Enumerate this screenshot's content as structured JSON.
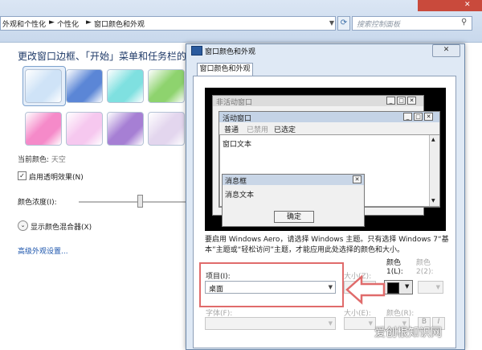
{
  "address_bar": {
    "crumbs": [
      "外观和个性化",
      "个性化",
      "窗口颜色和外观"
    ],
    "search_placeholder": "搜索控制面板"
  },
  "left": {
    "heading": "更改窗口边框、「开始」菜单和任务栏的",
    "current_color_label": "当前颜色:",
    "current_color_value": "天空",
    "transparency_label": "启用透明效果(N)",
    "transparency_checked": true,
    "intensity_label": "颜色浓度(I):",
    "intensity_level": 0.55,
    "mixer_label": "显示颜色混合器(X)",
    "advanced_link": "高级外观设置...",
    "swatch_colors": [
      "#cfe3f7",
      "#5b86d6",
      "#7fe0e0",
      "#8ed36e",
      "#f58ac9",
      "#f6c8ef",
      "#a67fd4",
      "#e3d6ee"
    ]
  },
  "dialog": {
    "title": "窗口颜色和外观",
    "close_label": "✕",
    "tab": "窗口颜色和外观",
    "preview": {
      "inactive_title": "非活动窗口",
      "active_title": "活动窗口",
      "menu": [
        "普通",
        "已禁用",
        "已选定"
      ],
      "window_text": "窗口文本",
      "message_title": "消息框",
      "message_text": "消息文本",
      "ok_label": "确定"
    },
    "description": "要启用 Windows Aero，请选择 Windows 主题。只有选择 Windows 7“基本”主题或“轻松访问”主题，才能应用此处选择的颜色和大小。",
    "item_label": "项目(I):",
    "item_value": "桌面",
    "size_label": "大小(Z):",
    "color1_label": "颜色 1(L):",
    "color2_label": "颜色 2(2):",
    "font_label": "字体(F):",
    "font_size_label": "大小(E):",
    "font_color_label": "颜色(R):",
    "bold_label": "B",
    "italic_label": "I",
    "colors": {
      "desktop_color": "#000000",
      "highlight": "#e06b6b"
    }
  },
  "watermark": "爱创根知识网"
}
